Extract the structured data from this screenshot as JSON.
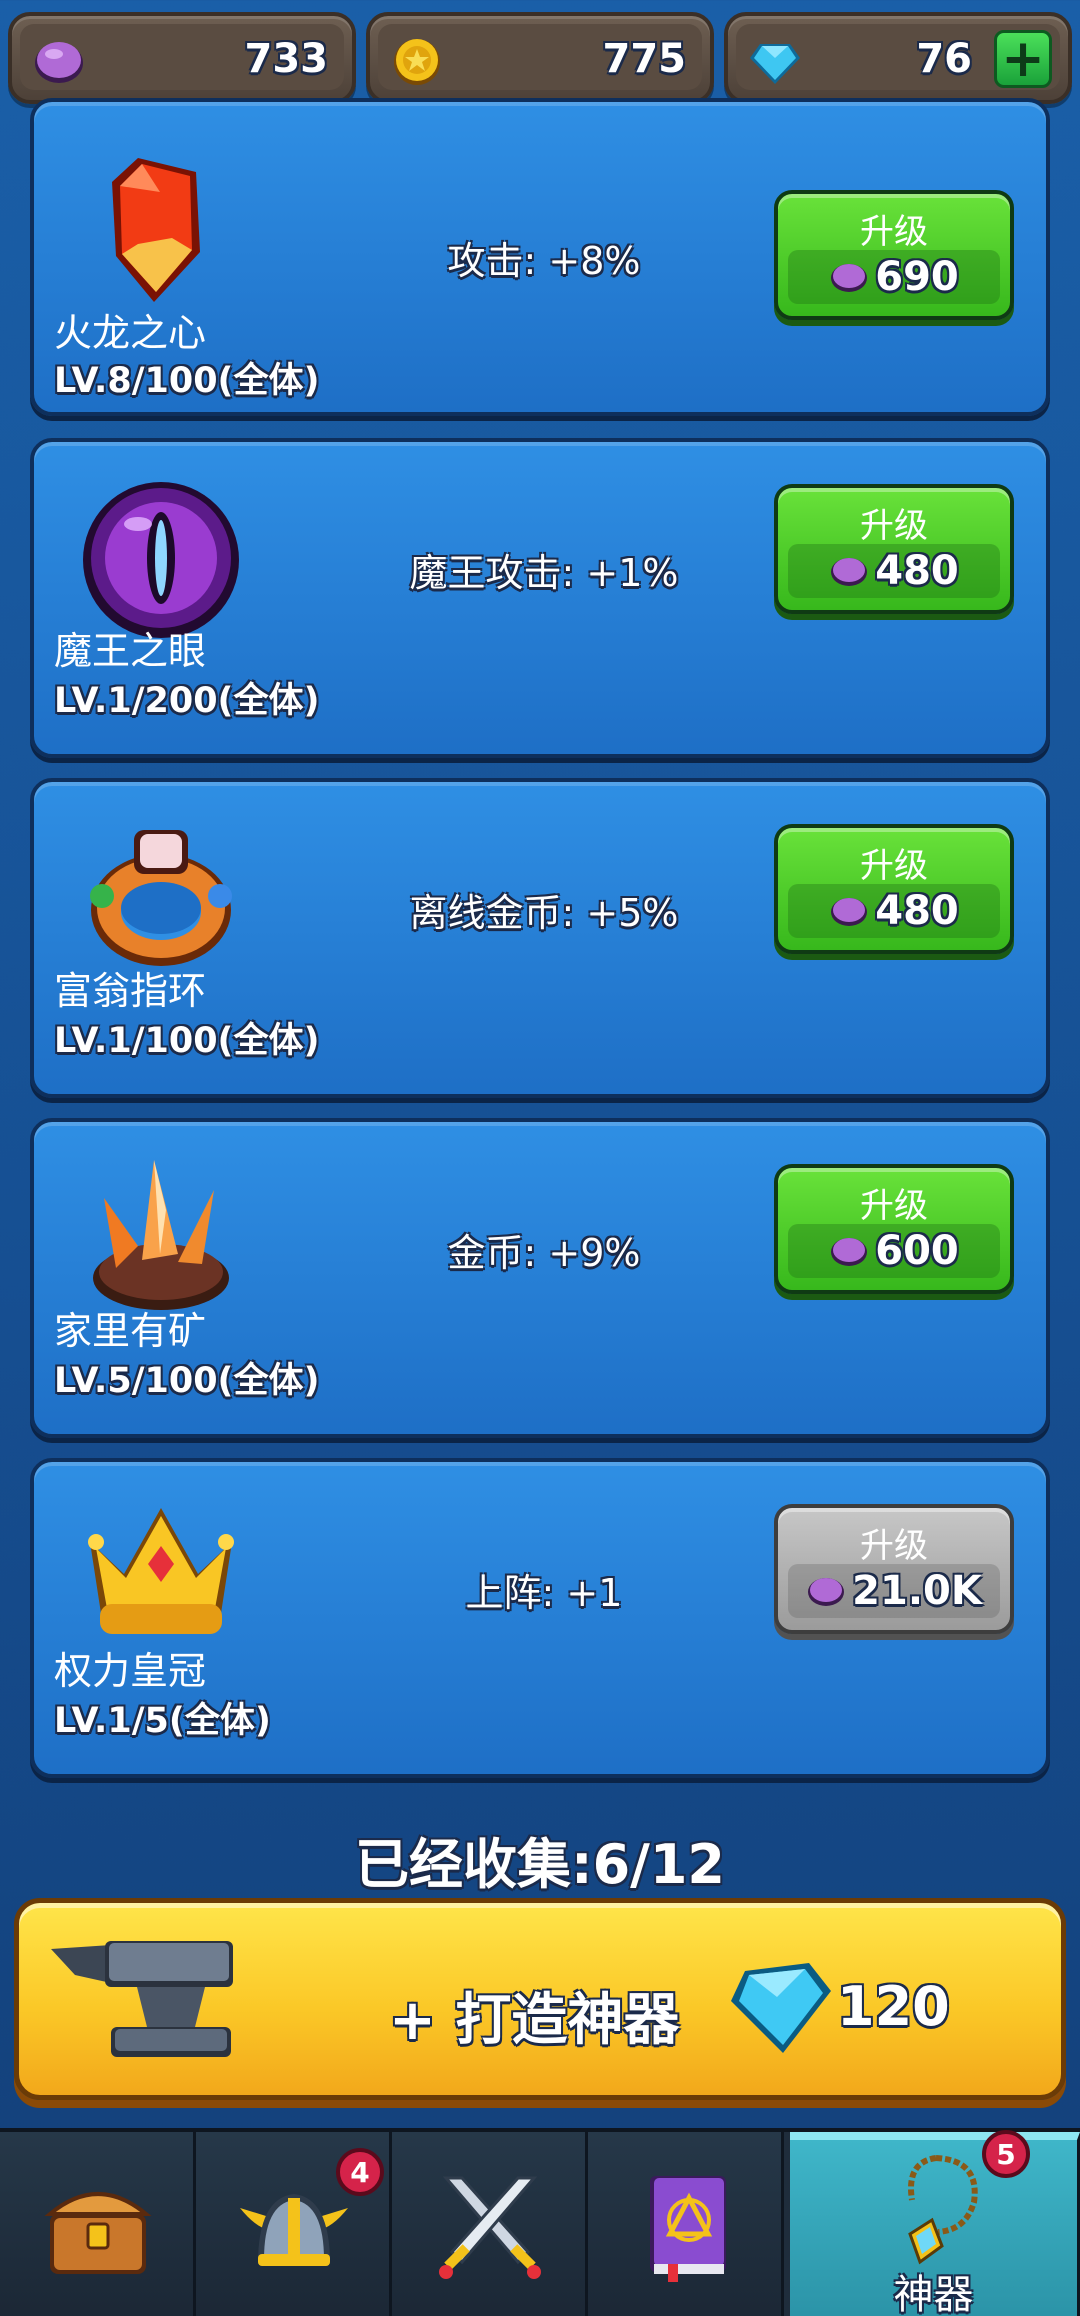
{
  "currencies": {
    "orbs": "733",
    "gold": "775",
    "gems": "76",
    "add_label": "+"
  },
  "artifacts": [
    {
      "name": "火龙之心",
      "level": "LV.8/100(全体)",
      "effect": "攻击: +8%",
      "upgrade_label": "升级",
      "cost": "690",
      "state": "affordable",
      "icon": "fire-crystal-icon"
    },
    {
      "name": "魔王之眼",
      "level": "LV.1/200(全体)",
      "effect": "魔王攻击: +1%",
      "upgrade_label": "升级",
      "cost": "480",
      "state": "affordable",
      "icon": "demon-eye-icon"
    },
    {
      "name": "富翁指环",
      "level": "LV.1/100(全体)",
      "effect": "离线金币: +5%",
      "upgrade_label": "升级",
      "cost": "480",
      "state": "affordable",
      "icon": "jeweled-ring-icon"
    },
    {
      "name": "家里有矿",
      "level": "LV.5/100(全体)",
      "effect": "金币: +9%",
      "upgrade_label": "升级",
      "cost": "600",
      "state": "affordable",
      "icon": "ore-crystals-icon"
    },
    {
      "name": "权力皇冠",
      "level": "LV.1/5(全体)",
      "effect": "上阵: +1",
      "upgrade_label": "升级",
      "cost": "21.0K",
      "state": "disabled",
      "icon": "gold-crown-icon"
    }
  ],
  "collected": "已经收集:6/12",
  "forge": {
    "label": "+ 打造神器",
    "price": "120"
  },
  "nav": {
    "tabs": [
      {
        "icon": "treasure-chest-icon",
        "badge": ""
      },
      {
        "icon": "viking-helmet-icon",
        "badge": "4"
      },
      {
        "icon": "crossed-swords-icon",
        "badge": ""
      },
      {
        "icon": "spellbook-icon",
        "badge": ""
      },
      {
        "icon": "amulet-icon",
        "badge": "5",
        "label": "神器",
        "active": true
      }
    ]
  },
  "colors": {
    "background": "#1a5fa8",
    "card": "#2f8fe4",
    "upgrade_green": "#4ecb2a",
    "upgrade_gray": "#aeaeae",
    "forge_yellow": "#fbc827",
    "badge_red": "#d5234a",
    "active_tab": "#3fb6c9"
  }
}
